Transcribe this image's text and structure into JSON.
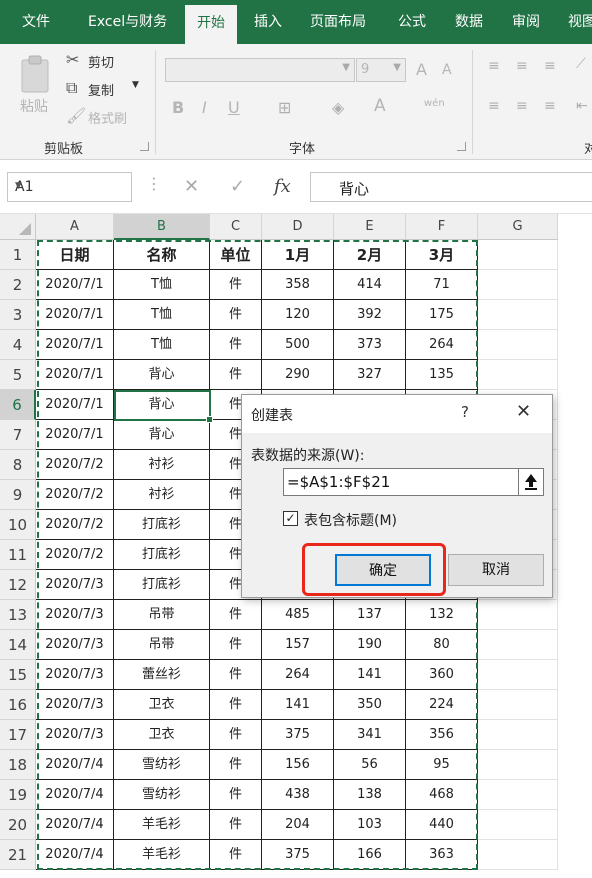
{
  "ribbon": {
    "tabs": [
      "文件",
      "Excel与财务",
      "开始",
      "插入",
      "页面布局",
      "公式",
      "数据",
      "审阅",
      "视图"
    ],
    "active_tab": "开始",
    "clipboard": {
      "paste": "粘贴",
      "cut": "剪切",
      "copy": "复制",
      "format_painter": "格式刷",
      "group_label": "剪贴板"
    },
    "font": {
      "size": "9",
      "group_label": "字体",
      "bold": "B",
      "italic": "I",
      "underline": "U",
      "grow": "A",
      "shrink": "A",
      "color": "A",
      "phonetic": "wén"
    },
    "alignment_group_label": "对"
  },
  "formula_bar": {
    "name_box": "A1",
    "cancel": "✕",
    "enter": "✓",
    "fx": "fx",
    "content": "背心"
  },
  "sheet": {
    "columns": [
      "A",
      "B",
      "C",
      "D",
      "E",
      "F",
      "G"
    ],
    "selected_column": "B",
    "selected_row": 6,
    "headers": [
      "日期",
      "名称",
      "单位",
      "1月",
      "2月",
      "3月"
    ],
    "rows": [
      {
        "num": "2",
        "date": "2020/7/1",
        "name": "T恤",
        "unit": "件",
        "m1": "358",
        "m2": "414",
        "m3": "71"
      },
      {
        "num": "3",
        "date": "2020/7/1",
        "name": "T恤",
        "unit": "件",
        "m1": "120",
        "m2": "392",
        "m3": "175"
      },
      {
        "num": "4",
        "date": "2020/7/1",
        "name": "T恤",
        "unit": "件",
        "m1": "500",
        "m2": "373",
        "m3": "264"
      },
      {
        "num": "5",
        "date": "2020/7/1",
        "name": "背心",
        "unit": "件",
        "m1": "290",
        "m2": "327",
        "m3": "135"
      },
      {
        "num": "6",
        "date": "2020/7/1",
        "name": "背心",
        "unit": "件",
        "m1": "",
        "m2": "",
        "m3": ""
      },
      {
        "num": "7",
        "date": "2020/7/1",
        "name": "背心",
        "unit": "件",
        "m1": "",
        "m2": "",
        "m3": ""
      },
      {
        "num": "8",
        "date": "2020/7/2",
        "name": "衬衫",
        "unit": "件",
        "m1": "",
        "m2": "",
        "m3": ""
      },
      {
        "num": "9",
        "date": "2020/7/2",
        "name": "衬衫",
        "unit": "件",
        "m1": "",
        "m2": "",
        "m3": ""
      },
      {
        "num": "10",
        "date": "2020/7/2",
        "name": "打底衫",
        "unit": "件",
        "m1": "",
        "m2": "",
        "m3": ""
      },
      {
        "num": "11",
        "date": "2020/7/2",
        "name": "打底衫",
        "unit": "件",
        "m1": "",
        "m2": "",
        "m3": ""
      },
      {
        "num": "12",
        "date": "2020/7/3",
        "name": "打底衫",
        "unit": "件",
        "m1": "",
        "m2": "",
        "m3": ""
      },
      {
        "num": "13",
        "date": "2020/7/3",
        "name": "吊带",
        "unit": "件",
        "m1": "485",
        "m2": "137",
        "m3": "132"
      },
      {
        "num": "14",
        "date": "2020/7/3",
        "name": "吊带",
        "unit": "件",
        "m1": "157",
        "m2": "190",
        "m3": "80"
      },
      {
        "num": "15",
        "date": "2020/7/3",
        "name": "蕾丝衫",
        "unit": "件",
        "m1": "264",
        "m2": "141",
        "m3": "360"
      },
      {
        "num": "16",
        "date": "2020/7/3",
        "name": "卫衣",
        "unit": "件",
        "m1": "141",
        "m2": "350",
        "m3": "224"
      },
      {
        "num": "17",
        "date": "2020/7/3",
        "name": "卫衣",
        "unit": "件",
        "m1": "375",
        "m2": "341",
        "m3": "356"
      },
      {
        "num": "18",
        "date": "2020/7/4",
        "name": "雪纺衫",
        "unit": "件",
        "m1": "156",
        "m2": "56",
        "m3": "95"
      },
      {
        "num": "19",
        "date": "2020/7/4",
        "name": "雪纺衫",
        "unit": "件",
        "m1": "438",
        "m2": "138",
        "m3": "468"
      },
      {
        "num": "20",
        "date": "2020/7/4",
        "name": "羊毛衫",
        "unit": "件",
        "m1": "204",
        "m2": "103",
        "m3": "440"
      },
      {
        "num": "21",
        "date": "2020/7/4",
        "name": "羊毛衫",
        "unit": "件",
        "m1": "375",
        "m2": "166",
        "m3": "363"
      }
    ]
  },
  "dialog": {
    "title": "创建表",
    "help": "?",
    "close": "✕",
    "source_label": "表数据的来源(W):",
    "range_value": "=$A$1:$F$21",
    "has_headers_label": "表包含标题(M)",
    "has_headers_checked": true,
    "ok_label": "确定",
    "cancel_label": "取消"
  }
}
